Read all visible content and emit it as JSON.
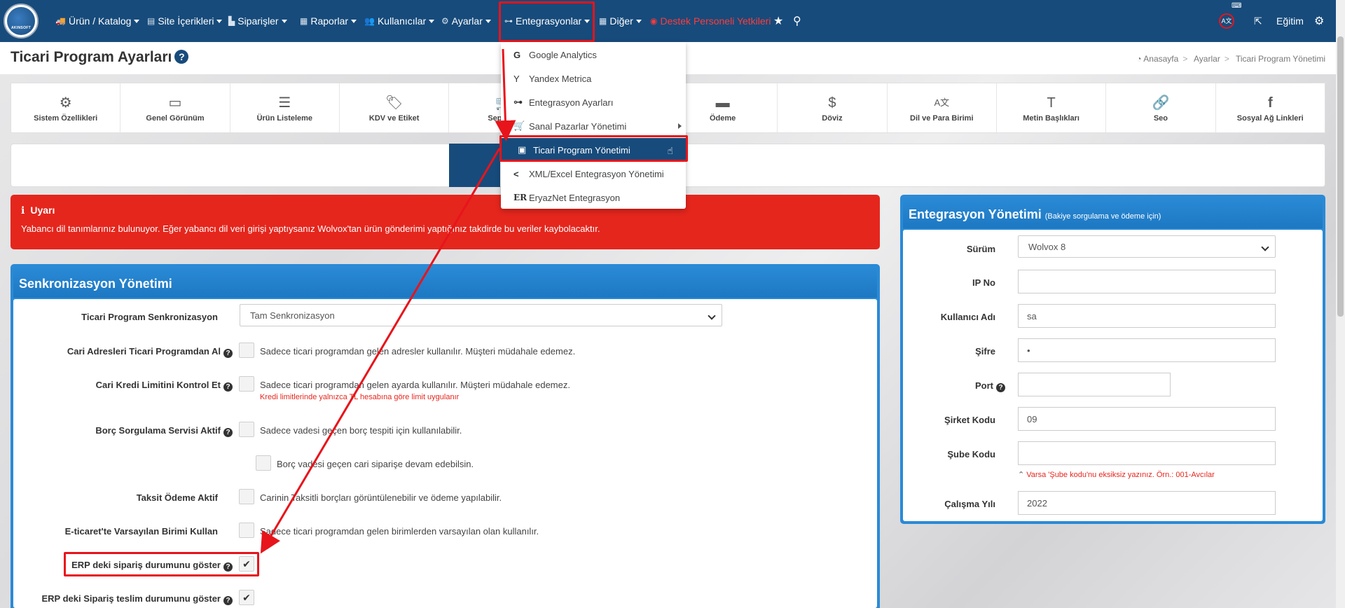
{
  "nav": {
    "logo_text": "AKINSOFT",
    "items": [
      {
        "label": "Ürün / Katalog",
        "icon": "truck-icon"
      },
      {
        "label": "Site İçerikleri",
        "icon": "file-icon"
      },
      {
        "label": "Siparişler",
        "icon": "shipping-icon"
      },
      {
        "label": "Raporlar",
        "icon": "report-icon"
      },
      {
        "label": "Kullanıcılar",
        "icon": "users-icon"
      },
      {
        "label": "Ayarlar",
        "icon": "gears-icon"
      },
      {
        "label": "Entegrasyonlar",
        "icon": "sitemap-icon"
      },
      {
        "label": "Diğer",
        "icon": "grid-icon"
      },
      {
        "label": "Destek Personeli Yetkileri",
        "icon": "support-icon"
      }
    ],
    "right_label": "Eğitim"
  },
  "page": {
    "title": "Ticari Program Ayarları",
    "breadcrumb": [
      "Anasayfa",
      "Ayarlar",
      "Ticari Program Yönetimi"
    ]
  },
  "tabs": [
    {
      "label": "Sistem Özellikleri",
      "icon": "⚙"
    },
    {
      "label": "Genel Görünüm",
      "icon": "▭"
    },
    {
      "label": "Ürün Listeleme",
      "icon": "☰"
    },
    {
      "label": "KDV ve Etiket",
      "icon": "🏷"
    },
    {
      "label": "Sepet ve",
      "icon": "🛒"
    },
    {
      "label": "",
      "icon": ""
    },
    {
      "label": "Ödeme",
      "icon": "▬"
    },
    {
      "label": "Döviz",
      "icon": "$"
    },
    {
      "label": "Dil ve Para Birimi",
      "icon": "A文"
    },
    {
      "label": "Metin Başlıkları",
      "icon": "T"
    },
    {
      "label": "Seo",
      "icon": "🔗"
    },
    {
      "label": "Sosyal Ağ Linkleri",
      "icon": "f"
    }
  ],
  "alert": {
    "title": "Uyarı",
    "message": "Yabancı dil tanımlarınız bulunuyor. Eğer yabancı dil veri girişi yaptıysanız Wolvox'tan ürün gönderimi yaptığınız takdirde bu veriler kaybolacaktır."
  },
  "sync": {
    "title": "Senkronizasyon Yönetimi",
    "rows": [
      {
        "label": "Ticari Program Senkronizasyon",
        "select": "Tam Senkronizasyon"
      },
      {
        "label": "Cari Adresleri Ticari Programdan Al",
        "text": "Sadece ticari programdan gelen adresler kullanılır. Müşteri müdahale edemez."
      },
      {
        "label": "Cari Kredi Limitini Kontrol Et",
        "text": "Sadece ticari programdan gelen ayarda kullanılır. Müşteri müdahale edemez.",
        "note": "Kredi limitlerinde yalnızca TL hesabına göre limit uygulanır"
      },
      {
        "label": "Borç Sorgulama Servisi Aktif",
        "text": "Sadece vadesi geçen borç tespiti için kullanılabilir."
      },
      {
        "label": "",
        "text": "Borç vadesi geçen cari siparişe devam edebilsin."
      },
      {
        "label": "Taksit Ödeme Aktif",
        "text": "Carinin Taksitli borçları görüntülenebilir ve ödeme yapılabilir."
      },
      {
        "label": "E-ticaret'te Varsayılan Birimi Kullan",
        "text": "Sadece ticari programdan gelen birimlerden varsayılan olan kullanılır."
      },
      {
        "label": "ERP deki sipariş durumunu göster",
        "checked": true
      },
      {
        "label": "ERP deki Sipariş teslim durumunu göster",
        "checked": true
      }
    ]
  },
  "integration": {
    "title": "Entegrasyon Yönetimi",
    "subtitle": "(Bakiye sorgulama ve ödeme için)",
    "fields": [
      {
        "label": "Sürüm",
        "value": "Wolvox 8"
      },
      {
        "label": "IP No",
        "value": ""
      },
      {
        "label": "Kullanıcı Adı",
        "value": "sa"
      },
      {
        "label": "Şifre",
        "value": "•"
      },
      {
        "label": "Port",
        "value": ""
      },
      {
        "label": "Şirket Kodu",
        "value": "09"
      },
      {
        "label": "Şube Kodu",
        "value": ""
      },
      {
        "label": "Çalışma Yılı",
        "value": "2022"
      }
    ],
    "branch_note": "Varsa 'Şube kodu'nu eksiksiz yazınız. Örn.: 001-Avcılar"
  },
  "dropdown": {
    "items": [
      {
        "label": "Google Analytics",
        "icon": "G"
      },
      {
        "label": "Yandex Metrica",
        "icon": "Y"
      },
      {
        "label": "Entegrasyon Ayarları",
        "icon": "⊶"
      },
      {
        "label": "Sanal Pazarlar Yönetimi",
        "icon": "🛒"
      },
      {
        "label": "Ticari Program Yönetimi",
        "icon": "▣"
      },
      {
        "label": "XML/Excel Entegrasyon Yönetimi",
        "icon": "<"
      },
      {
        "label": "EryazNet Entegrasyon",
        "icon": "ER"
      }
    ]
  },
  "colors": {
    "navbar": "#174b7b",
    "highlight": "#e8141b",
    "panel": "#2a8ad6",
    "alert": "#e5261d"
  }
}
